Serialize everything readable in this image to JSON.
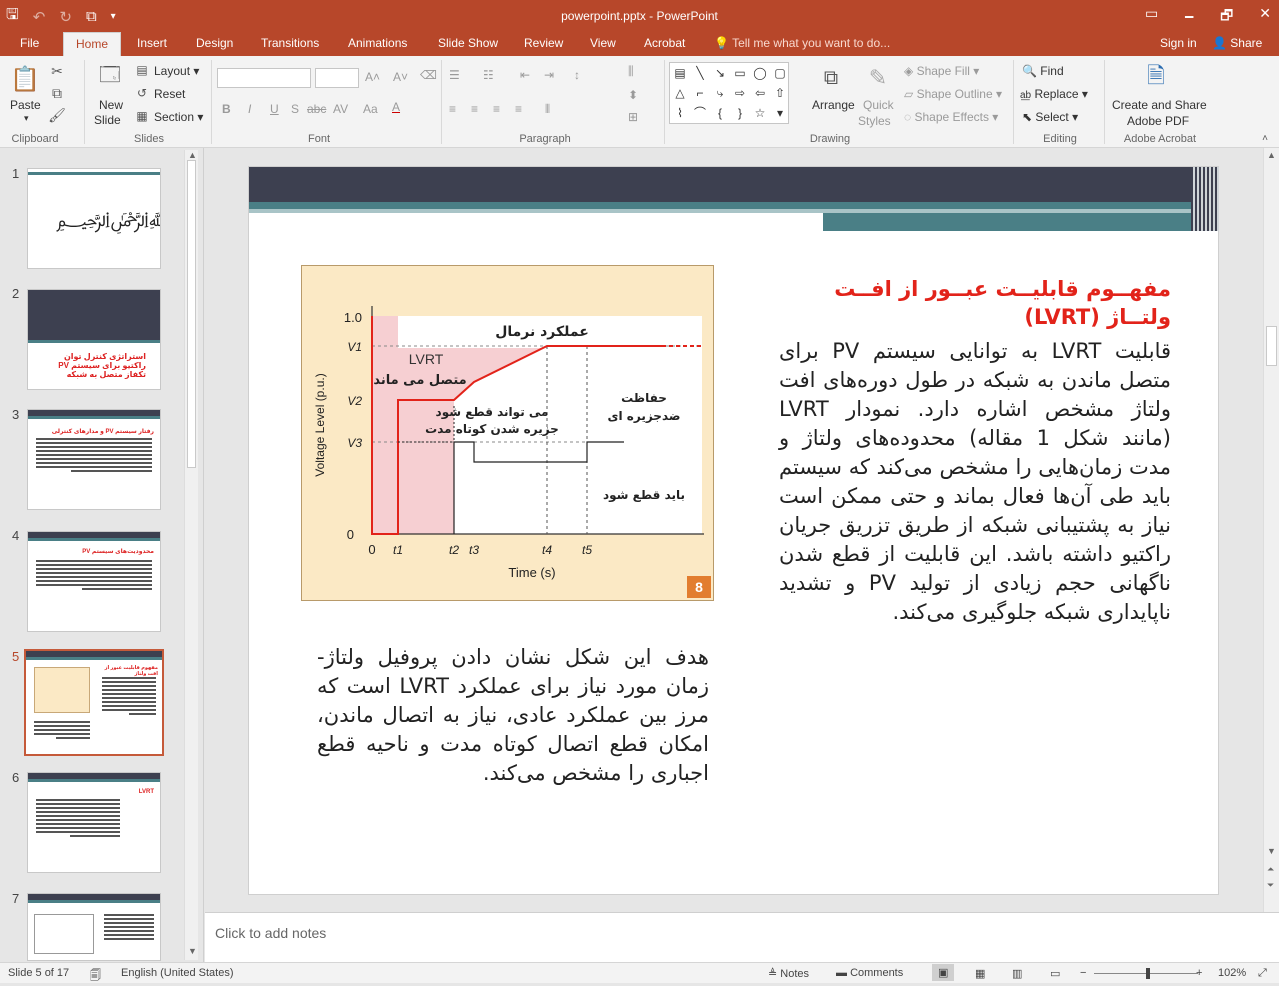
{
  "window": {
    "doc_title": "powerpoint.pptx - PowerPoint",
    "min_glyph": "🗕",
    "restore_glyph": "🗗",
    "close_glyph": "✕"
  },
  "tabs": [
    "File",
    "Home",
    "Insert",
    "Design",
    "Transitions",
    "Animations",
    "Slide Show",
    "Review",
    "View",
    "Acrobat"
  ],
  "tell_me": "Tell me what you want to do...",
  "sign_in": "Sign in",
  "share": "Share",
  "ribbon": {
    "clipboard": {
      "paste": "Paste",
      "label": "Clipboard"
    },
    "slides": {
      "new_slide_1": "New",
      "new_slide_2": "Slide",
      "layout": "Layout",
      "reset": "Reset",
      "section": "Section",
      "label": "Slides"
    },
    "font": {
      "label": "Font",
      "bold": "B",
      "italic": "I",
      "underline": "U",
      "strike": "S",
      "abc": "abc",
      "av": "AV",
      "aa": "Aa"
    },
    "paragraph": {
      "label": "Paragraph"
    },
    "drawing": {
      "arrange": "Arrange",
      "quick_styles_1": "Quick",
      "quick_styles_2": "Styles",
      "shape_fill": "Shape Fill",
      "shape_outline": "Shape Outline",
      "shape_effects": "Shape Effects",
      "label": "Drawing"
    },
    "editing": {
      "find": "Find",
      "replace": "Replace",
      "select": "Select",
      "label": "Editing"
    },
    "acrobat": {
      "create_1": "Create and Share",
      "create_2": "Adobe PDF",
      "label": "Adobe Acrobat"
    }
  },
  "thumbnails": [
    {
      "num": "1"
    },
    {
      "num": "2",
      "text": "استراتژی کنترل توان راکتیو برای سیستم PV تکفاز متصل به شبکه"
    },
    {
      "num": "3",
      "text": "رفتار سیستم PV و مدارهای کنترلی"
    },
    {
      "num": "4",
      "text": "محدودیت‌های سیستم PV"
    },
    {
      "num": "5",
      "text": "مفهوم قابلیت عبور از افت ولتاژ"
    },
    {
      "num": "6",
      "text": "LVRT"
    },
    {
      "num": "7",
      "text": ""
    }
  ],
  "slide": {
    "title": "مفهــوم قابلیــت عبــور از افــت ولتــاژ (LVRT)",
    "body": "قابلیت LVRT به توانایی سیستم PV برای متصل ماندن به شبکه در طول دوره‌های افت ولتاژ مشخص اشاره دارد. نمودار LVRT (مانند شکل 1 مقاله) محدوده‌های ولتاژ و مدت زمان‌هایی را مشخص می‌کند که سیستم باید طی آن‌ها فعال بماند و حتی ممکن است نیاز به پشتیبانی شبکه از طریق تزریق جریان راکتیو داشته باشد. این قابلیت از قطع شدن ناگهانی حجم زیادی از تولید PV و تشدید ناپایداری شبکه جلوگیری می‌کند.",
    "caption": "هدف این شکل نشان دادن پروفیل ولتاژ-زمان مورد نیاز برای عملکرد LVRT است که مرز بین عملکرد عادی، نیاز به اتصال ماندن، امکان قطع اتصال کوتاه مدت و ناحیه قطع اجباری را مشخص می‌کند."
  },
  "figure": {
    "badge": "8",
    "ylabel": "Voltage Level (p.u.)",
    "xlabel": "Time (s)",
    "y_ticks": [
      "1.0",
      "V1",
      "V2",
      "V3",
      "0"
    ],
    "x_ticks": [
      "0",
      "t1",
      "t2",
      "t3",
      "t4",
      "t5"
    ],
    "labels": {
      "normal": "عملکرد نرمال",
      "lvrt": "LVRT",
      "stay": "متصل می ماند",
      "may_trip_1": "می تواند قطع شود",
      "may_trip_2": "جزیره شدن کوتاه مدت",
      "protect_1": "حفاظت",
      "protect_2": "ضدجزیره ای",
      "must_trip": "باید قطع شود"
    }
  },
  "notes_placeholder": "Click to add notes",
  "status": {
    "slide": "Slide 5 of 17",
    "language": "English (United States)",
    "notes": "Notes",
    "comments": "Comments",
    "zoom": "102%"
  }
}
